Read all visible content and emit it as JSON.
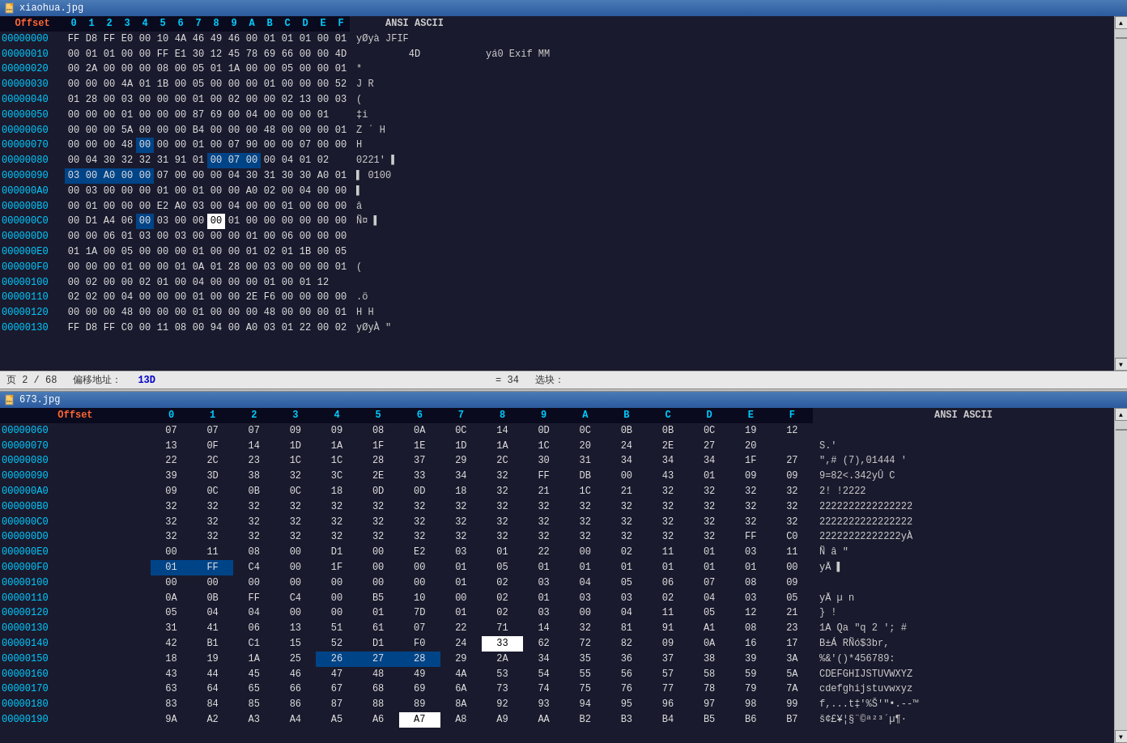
{
  "panels": [
    {
      "id": "panel1",
      "filename": "xiaohua.jpg",
      "rows": [
        {
          "offset": "00000000",
          "bytes": [
            "FF",
            "D8",
            "FF",
            "E0",
            "00",
            "10",
            "4A",
            "46",
            "49",
            "46",
            "00",
            "01",
            "01",
            "01",
            "00",
            "01"
          ],
          "ansi": "yØyà  JFIF"
        },
        {
          "offset": "00000010",
          "bytes": [
            "00",
            "01",
            "01",
            "00",
            "00",
            "FF",
            "E1",
            "30",
            "12",
            "45",
            "78",
            "69",
            "66",
            "00",
            "00",
            "4D",
            "4D"
          ],
          "ansi": "  yá0  Exif  MM"
        },
        {
          "offset": "00000020",
          "bytes": [
            "00",
            "2A",
            "00",
            "00",
            "00",
            "08",
            "00",
            "05",
            "01",
            "1A",
            "00",
            "00",
            "05",
            "00",
            "00",
            "01"
          ],
          "ansi": "*"
        },
        {
          "offset": "00000030",
          "bytes": [
            "00",
            "00",
            "00",
            "4A",
            "01",
            "1B",
            "00",
            "05",
            "00",
            "00",
            "00",
            "01",
            "00",
            "00",
            "00",
            "52"
          ],
          "ansi": "   J              R"
        },
        {
          "offset": "00000040",
          "bytes": [
            "01",
            "28",
            "00",
            "03",
            "00",
            "00",
            "00",
            "01",
            "00",
            "02",
            "00",
            "00",
            "02",
            "13",
            "00",
            "03"
          ],
          "ansi": "("
        },
        {
          "offset": "00000050",
          "bytes": [
            "00",
            "00",
            "00",
            "01",
            "00",
            "00",
            "00",
            "87",
            "69",
            "00",
            "04",
            "00",
            "00",
            "00",
            "01"
          ],
          "ansi": "       ‡i"
        },
        {
          "offset": "00000060",
          "bytes": [
            "00",
            "00",
            "00",
            "5A",
            "00",
            "00",
            "00",
            "B4",
            "00",
            "00",
            "00",
            "48",
            "00",
            "00",
            "00",
            "01"
          ],
          "ansi": "   Z   ´   H"
        },
        {
          "offset": "00000070",
          "bytes": [
            "00",
            "00",
            "00",
            "48",
            "00",
            "00",
            "00",
            "01",
            "00",
            "07",
            "90",
            "00",
            "00",
            "07",
            "00",
            "00"
          ],
          "ansi": "   H"
        },
        {
          "offset": "00000080",
          "bytes": [
            "00",
            "04",
            "30",
            "32",
            "32",
            "31",
            "91",
            "01",
            "00",
            "07",
            "00",
            "00",
            "04",
            "01",
            "02"
          ],
          "ansi": " 0221'   ▌"
        },
        {
          "offset": "00000090",
          "bytes": [
            "03",
            "00",
            "A0",
            "00",
            "00",
            "07",
            "00",
            "00",
            "00",
            "04",
            "30",
            "31",
            "30",
            "30",
            "A0",
            "01"
          ],
          "ansi": "    ▌         0100"
        },
        {
          "offset": "000000A0",
          "bytes": [
            "00",
            "03",
            "00",
            "00",
            "00",
            "01",
            "00",
            "01",
            "00",
            "00",
            "A0",
            "02",
            "00",
            "04",
            "00",
            "00"
          ],
          "ansi": "   ▌"
        },
        {
          "offset": "000000B0",
          "bytes": [
            "00",
            "01",
            "00",
            "00",
            "00",
            "E2",
            "A0",
            "03",
            "00",
            "04",
            "00",
            "00",
            "01",
            "00",
            "00",
            "00"
          ],
          "ansi": "    â"
        },
        {
          "offset": "000000C0",
          "bytes": [
            "00",
            "D1",
            "A4",
            "06",
            "00",
            "03",
            "00",
            "00",
            "00",
            "01",
            "00",
            "00",
            "00",
            "00",
            "00",
            "00"
          ],
          "ansi": "Ñ¤   ▌"
        },
        {
          "offset": "000000D0",
          "bytes": [
            "00",
            "00",
            "06",
            "01",
            "03",
            "00",
            "03",
            "00",
            "00",
            "00",
            "01",
            "00",
            "06",
            "00",
            "00",
            "00"
          ],
          "ansi": ""
        },
        {
          "offset": "000000E0",
          "bytes": [
            "01",
            "1A",
            "00",
            "05",
            "00",
            "00",
            "00",
            "01",
            "00",
            "00",
            "01",
            "02",
            "01",
            "1B",
            "00",
            "05"
          ],
          "ansi": ""
        },
        {
          "offset": "000000F0",
          "bytes": [
            "00",
            "00",
            "00",
            "01",
            "00",
            "00",
            "01",
            "0A",
            "01",
            "28",
            "00",
            "03",
            "00",
            "00",
            "00",
            "01"
          ],
          "ansi": "       ("
        },
        {
          "offset": "00000100",
          "bytes": [
            "00",
            "02",
            "00",
            "00",
            "02",
            "01",
            "00",
            "04",
            "00",
            "00",
            "00",
            "01",
            "00",
            "01",
            "12"
          ],
          "ansi": ""
        },
        {
          "offset": "00000110",
          "bytes": [
            "02",
            "02",
            "00",
            "04",
            "00",
            "00",
            "00",
            "01",
            "00",
            "00",
            "2E",
            "F6",
            "00",
            "00",
            "00",
            "00"
          ],
          "ansi": "          .ö"
        },
        {
          "offset": "00000120",
          "bytes": [
            "00",
            "00",
            "00",
            "48",
            "00",
            "00",
            "00",
            "01",
            "00",
            "00",
            "00",
            "48",
            "00",
            "00",
            "00",
            "01"
          ],
          "ansi": "   H           H"
        },
        {
          "offset": "00000130",
          "bytes": [
            "FF",
            "D8",
            "FF",
            "C0",
            "00",
            "11",
            "08",
            "00",
            "94",
            "00",
            "A0",
            "03",
            "01",
            "22",
            "00",
            "02"
          ],
          "ansi": "yØyÀ      \""
        }
      ],
      "col_headers": [
        "0",
        "1",
        "2",
        "3",
        "4",
        "5",
        "6",
        "7",
        "8",
        "9",
        "A",
        "B",
        "C",
        "D",
        "E",
        "F"
      ],
      "ansi_header": "ANSI ASCII",
      "status": {
        "page": "页 2 / 68",
        "offset_label": "偏移地址：",
        "offset_value": "13D",
        "eq_label": "= 34",
        "block_label": "选块："
      }
    },
    {
      "id": "panel2",
      "filename": "673.jpg",
      "rows": [
        {
          "offset": "00000060",
          "bytes": [
            "07",
            "07",
            "07",
            "09",
            "09",
            "08",
            "0A",
            "0C",
            "14",
            "0D",
            "0C",
            "0B",
            "0B",
            "0C",
            "19",
            "12"
          ],
          "ansi": ""
        },
        {
          "offset": "00000070",
          "bytes": [
            "13",
            "0F",
            "14",
            "1D",
            "1A",
            "1F",
            "1E",
            "1D",
            "1A",
            "1C",
            "20",
            "24",
            "2E",
            "27",
            "20"
          ],
          "ansi": "          S.'"
        },
        {
          "offset": "00000080",
          "bytes": [
            "22",
            "2C",
            "23",
            "1C",
            "1C",
            "28",
            "37",
            "29",
            "2C",
            "30",
            "31",
            "34",
            "34",
            "34",
            "1F",
            "27"
          ],
          "ansi": "\",#  (7),01444 '"
        },
        {
          "offset": "00000090",
          "bytes": [
            "39",
            "3D",
            "38",
            "32",
            "3C",
            "2E",
            "33",
            "34",
            "32",
            "FF",
            "DB",
            "00",
            "43",
            "01",
            "09",
            "09"
          ],
          "ansi": "9=82<.342yÛ C"
        },
        {
          "offset": "000000A0",
          "bytes": [
            "09",
            "0C",
            "0B",
            "0C",
            "18",
            "0D",
            "0D",
            "18",
            "32",
            "21",
            "1C",
            "21",
            "32",
            "32",
            "32",
            "32"
          ],
          "ansi": "         2! !2222"
        },
        {
          "offset": "000000B0",
          "bytes": [
            "32",
            "32",
            "32",
            "32",
            "32",
            "32",
            "32",
            "32",
            "32",
            "32",
            "32",
            "32",
            "32",
            "32",
            "32",
            "32"
          ],
          "ansi": "2222222222222222"
        },
        {
          "offset": "000000C0",
          "bytes": [
            "32",
            "32",
            "32",
            "32",
            "32",
            "32",
            "32",
            "32",
            "32",
            "32",
            "32",
            "32",
            "32",
            "32",
            "32",
            "32"
          ],
          "ansi": "2222222222222222"
        },
        {
          "offset": "000000D0",
          "bytes": [
            "32",
            "32",
            "32",
            "32",
            "32",
            "32",
            "32",
            "32",
            "32",
            "32",
            "32",
            "32",
            "32",
            "32",
            "FF",
            "C0"
          ],
          "ansi": "22222222222222yÀ"
        },
        {
          "offset": "000000E0",
          "bytes": [
            "00",
            "11",
            "08",
            "00",
            "D1",
            "00",
            "E2",
            "03",
            "01",
            "22",
            "00",
            "02",
            "11",
            "01",
            "03",
            "11"
          ],
          "ansi": "    Ñ â  \""
        },
        {
          "offset": "000000F0",
          "bytes": [
            "01",
            "FF",
            "C4",
            "00",
            "1F",
            "00",
            "00",
            "01",
            "05",
            "01",
            "01",
            "01",
            "01",
            "01",
            "01",
            "00"
          ],
          "ansi": " yÄ  ▌"
        },
        {
          "offset": "00000100",
          "bytes": [
            "00",
            "00",
            "00",
            "00",
            "00",
            "00",
            "00",
            "01",
            "02",
            "03",
            "04",
            "05",
            "06",
            "07",
            "08",
            "09"
          ],
          "ansi": ""
        },
        {
          "offset": "00000110",
          "bytes": [
            "0A",
            "0B",
            "FF",
            "C4",
            "00",
            "B5",
            "10",
            "00",
            "02",
            "01",
            "03",
            "03",
            "02",
            "04",
            "03",
            "05"
          ],
          "ansi": "  yÄ µ        n"
        },
        {
          "offset": "00000120",
          "bytes": [
            "05",
            "04",
            "04",
            "00",
            "00",
            "01",
            "7D",
            "01",
            "02",
            "03",
            "00",
            "04",
            "11",
            "05",
            "12",
            "21"
          ],
          "ansi": "        }        !"
        },
        {
          "offset": "00000130",
          "bytes": [
            "31",
            "41",
            "06",
            "13",
            "51",
            "61",
            "07",
            "22",
            "71",
            "14",
            "32",
            "81",
            "91",
            "A1",
            "08",
            "23"
          ],
          "ansi": "1A  Qa \"q 2 '; #"
        },
        {
          "offset": "00000140",
          "bytes": [
            "42",
            "B1",
            "C1",
            "15",
            "52",
            "D1",
            "F0",
            "24",
            "33",
            "62",
            "72",
            "82",
            "09",
            "0A",
            "16",
            "17"
          ],
          "ansi": "B±Á RÑó$3br,"
        },
        {
          "offset": "00000150",
          "bytes": [
            "18",
            "19",
            "1A",
            "25",
            "26",
            "27",
            "28",
            "29",
            "2A",
            "34",
            "35",
            "36",
            "37",
            "38",
            "39",
            "3A"
          ],
          "ansi": "   %&'()*456789:"
        },
        {
          "offset": "00000160",
          "bytes": [
            "43",
            "44",
            "45",
            "46",
            "47",
            "48",
            "49",
            "4A",
            "53",
            "54",
            "55",
            "56",
            "57",
            "58",
            "59",
            "5A"
          ],
          "ansi": "CDEFGHIJSTUVWXYZ"
        },
        {
          "offset": "00000170",
          "bytes": [
            "63",
            "64",
            "65",
            "66",
            "67",
            "68",
            "69",
            "6A",
            "73",
            "74",
            "75",
            "76",
            "77",
            "78",
            "79",
            "7A"
          ],
          "ansi": "cdefghijstuvwxyz"
        },
        {
          "offset": "00000180",
          "bytes": [
            "83",
            "84",
            "85",
            "86",
            "87",
            "88",
            "89",
            "8A",
            "92",
            "93",
            "94",
            "95",
            "96",
            "97",
            "98",
            "99"
          ],
          "ansi": "f,...t‡'%Š'\"•.--™"
        },
        {
          "offset": "00000190",
          "bytes": [
            "9A",
            "A2",
            "A3",
            "A4",
            "A5",
            "A6",
            "A7",
            "A8",
            "A9",
            "AA",
            "B2",
            "B3",
            "B4",
            "B5",
            "B6",
            "B7"
          ],
          "ansi": "š¢£¥¦§¨©ª²³´µ¶·"
        }
      ],
      "col_headers": [
        "0",
        "1",
        "2",
        "3",
        "4",
        "5",
        "6",
        "7",
        "8",
        "9",
        "A",
        "B",
        "C",
        "D",
        "E",
        "F"
      ],
      "ansi_header": "ANSI ASCII",
      "offset_label": "Offset"
    }
  ]
}
